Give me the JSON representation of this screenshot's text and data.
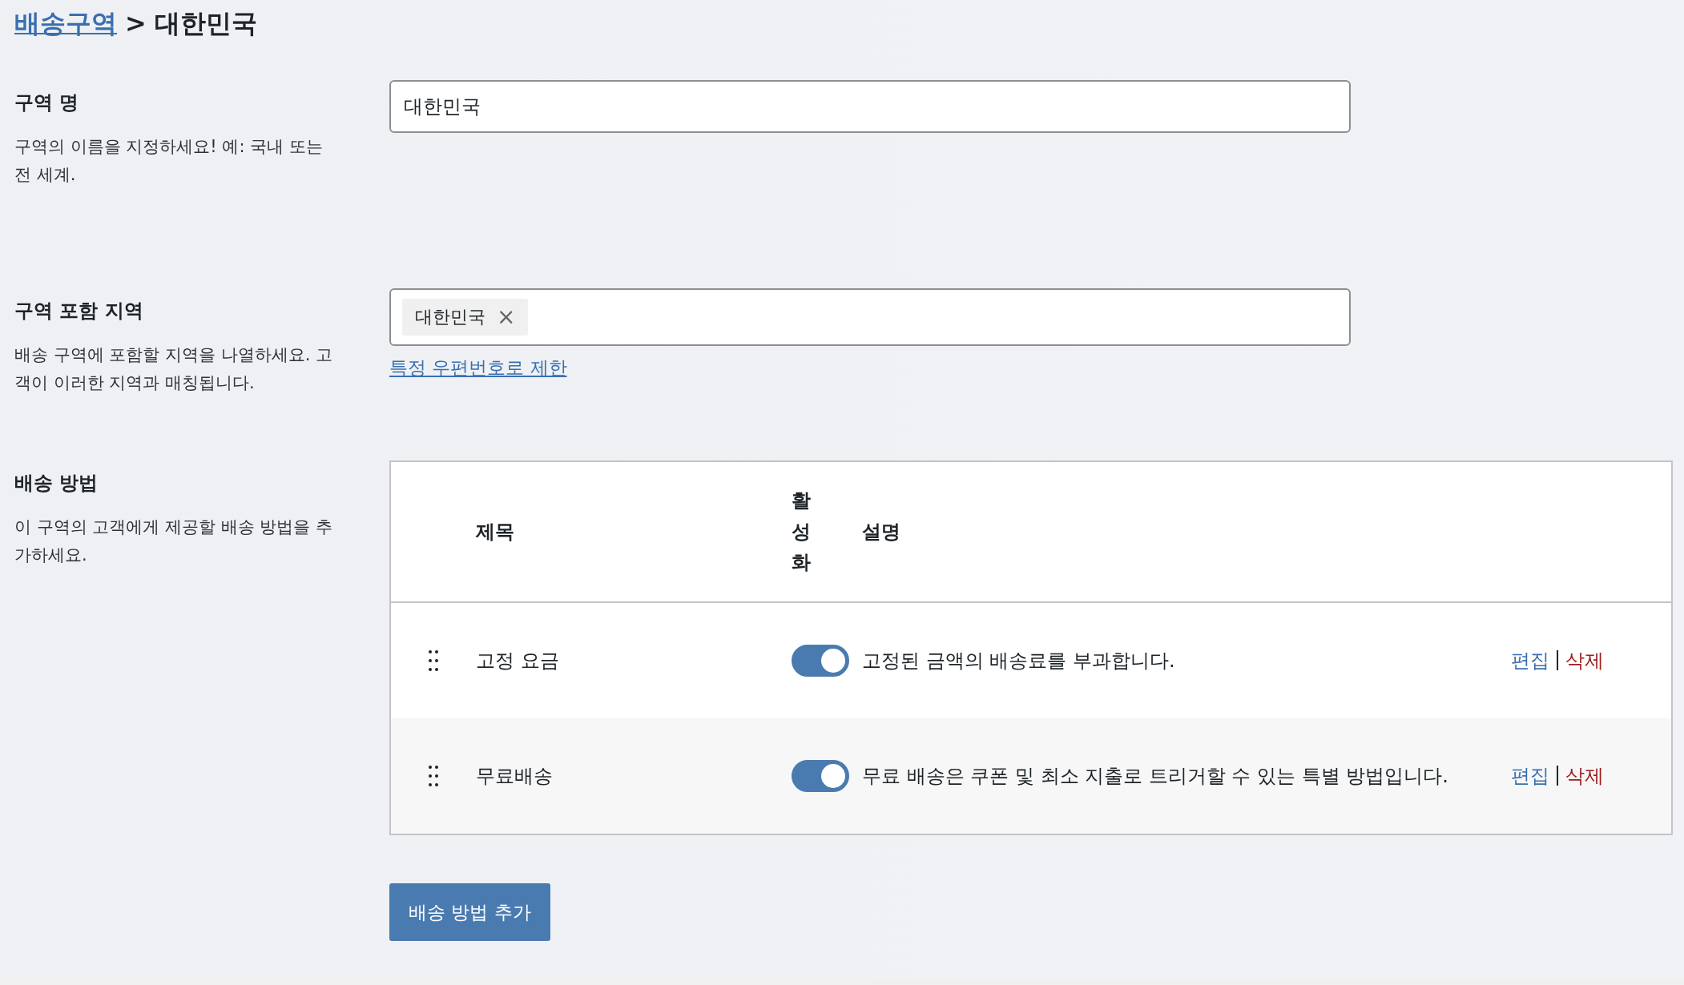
{
  "breadcrumb": {
    "link": "배송구역",
    "separator": ">",
    "current": "대한민국"
  },
  "zone_name": {
    "label": "구역 명",
    "description": "구역의 이름을 지정하세요! 예: 국내 또는 전 세계.",
    "value": "대한민국"
  },
  "zone_regions": {
    "label": "구역 포함 지역",
    "description": "배송 구역에 포함할 지역을 나열하세요. 고객이 이러한 지역과 매칭됩니다.",
    "tags": [
      {
        "label": "대한민국",
        "remove": "×"
      }
    ],
    "link": "특정 우편번호로 제한"
  },
  "shipping_methods": {
    "label": "배송 방법",
    "description": "이 구역의 고객에게 제공할 배송 방법을 추가하세요.",
    "columns": [
      "제목",
      "활성화",
      "설명"
    ],
    "rows": [
      {
        "title": "고정 요금",
        "enabled": true,
        "description": "고정된 금액의 배송료를 부과합니다.",
        "edit": "편집",
        "separator": "|",
        "delete": "삭제"
      },
      {
        "title": "무료배송",
        "enabled": true,
        "description": "무료 배송은 쿠폰 및 최소 지출로 트리거할 수 있는 특별 방법입니다.",
        "edit": "편집",
        "separator": "|",
        "delete": "삭제"
      }
    ],
    "add_button": "배송 방법 추가"
  }
}
